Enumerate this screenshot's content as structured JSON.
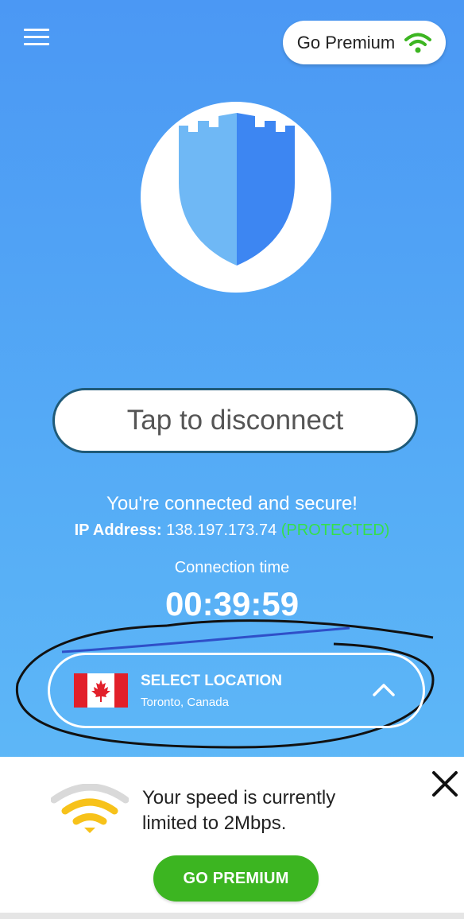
{
  "header": {
    "menu_icon": "hamburger-menu-icon",
    "premium_button_label": "Go Premium",
    "premium_icon": "wifi-icon"
  },
  "logo": {
    "icon": "castle-shield-icon"
  },
  "main": {
    "disconnect_label": "Tap to disconnect",
    "status_message": "You're connected and secure!",
    "ip_label": "IP Address:",
    "ip_value": "138.197.173.74",
    "ip_status": "(PROTECTED)",
    "connection_time_label": "Connection time",
    "connection_time": "00:39:59"
  },
  "location": {
    "title": "SELECT LOCATION",
    "subtitle": "Toronto, Canada",
    "flag_icon": "canada-flag-icon",
    "chevron_icon": "chevron-up-icon"
  },
  "ad": {
    "message": "Your speed is currently limited to 2Mbps.",
    "button_label": "GO PREMIUM",
    "close_icon": "close-icon",
    "wifi_icon": "wifi-icon"
  },
  "colors": {
    "background_top": "#4b98f4",
    "background_bottom": "#62bdf8",
    "protected_green": "#35e04a",
    "premium_green": "#3cb521",
    "wifi_green": "#3cb521",
    "wifi_yellow": "#f7c21a"
  }
}
